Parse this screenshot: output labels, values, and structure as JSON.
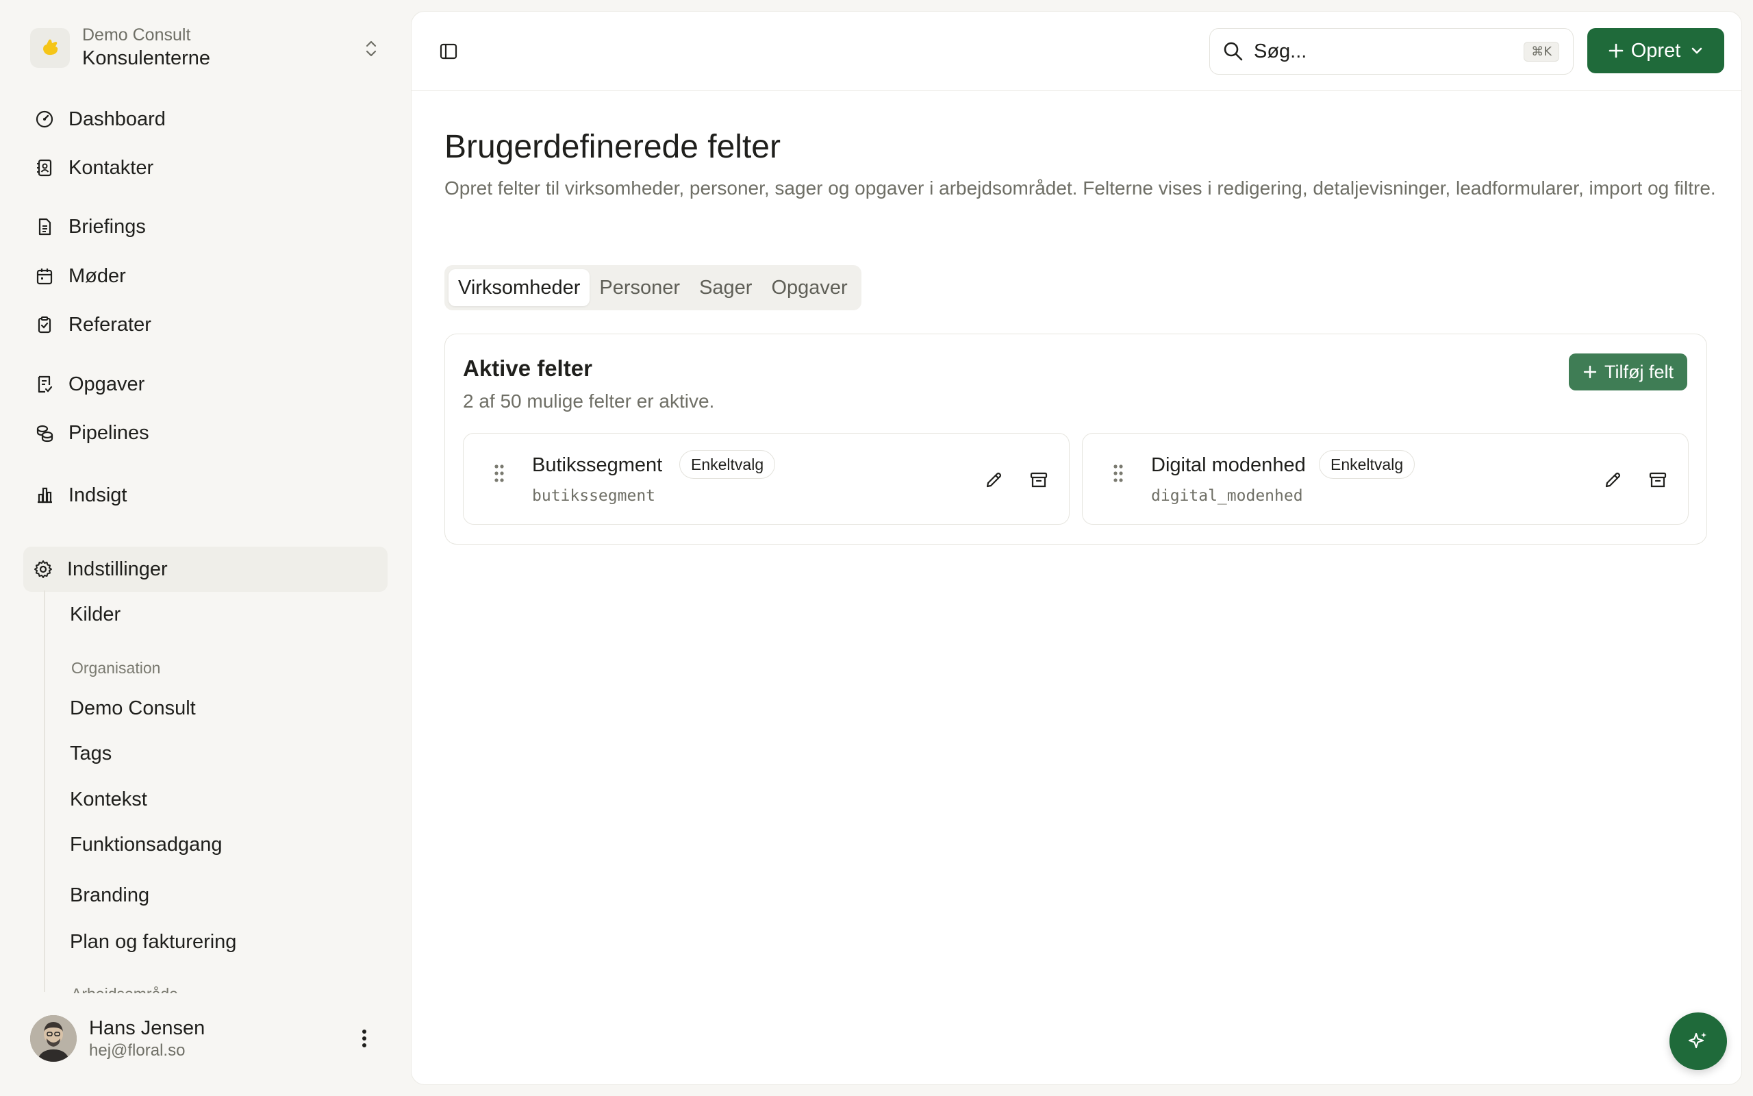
{
  "workspace": {
    "org": "Demo Consult",
    "name": "Konsulenterne"
  },
  "nav": {
    "dashboard": "Dashboard",
    "contacts": "Kontakter",
    "briefings": "Briefings",
    "meetings": "Møder",
    "minutes": "Referater",
    "tasks": "Opgaver",
    "pipelines": "Pipelines",
    "insight": "Indsigt",
    "settings": "Indstillinger"
  },
  "settings_sub": {
    "sources": "Kilder",
    "org_heading": "Organisation",
    "demo_consult": "Demo Consult",
    "tags": "Tags",
    "context": "Kontekst",
    "feature_access": "Funktionsadgang",
    "branding": "Branding",
    "plan_billing": "Plan og fakturering",
    "workspace_heading": "Arbejdsområde"
  },
  "user": {
    "name": "Hans Jensen",
    "email": "hej@floral.so"
  },
  "topbar": {
    "search_placeholder": "Søg...",
    "search_shortcut": "⌘K",
    "create_label": "Opret"
  },
  "page": {
    "title": "Brugerdefinerede felter",
    "description": "Opret felter til virksomheder, personer, sager og opgaver i arbejdsområdet. Felterne vises i redigering, detaljevisninger, leadformularer, import og filtre."
  },
  "tabs": [
    "Virksomheder",
    "Personer",
    "Sager",
    "Opgaver"
  ],
  "active_tab": "Virksomheder",
  "active_fields": {
    "title": "Aktive felter",
    "subtitle": "2 af 50 mulige felter er aktive.",
    "add_label": "Tilføj felt",
    "fields": [
      {
        "name": "Butikssegment",
        "type": "Enkeltvalg",
        "key": "butikssegment"
      },
      {
        "name": "Digital modenhed",
        "type": "Enkeltvalg",
        "key": "digital_modenhed"
      }
    ]
  },
  "colors": {
    "brand": "#1f6a3a",
    "add_button": "#3f7d55",
    "logo": "#f5c518"
  }
}
